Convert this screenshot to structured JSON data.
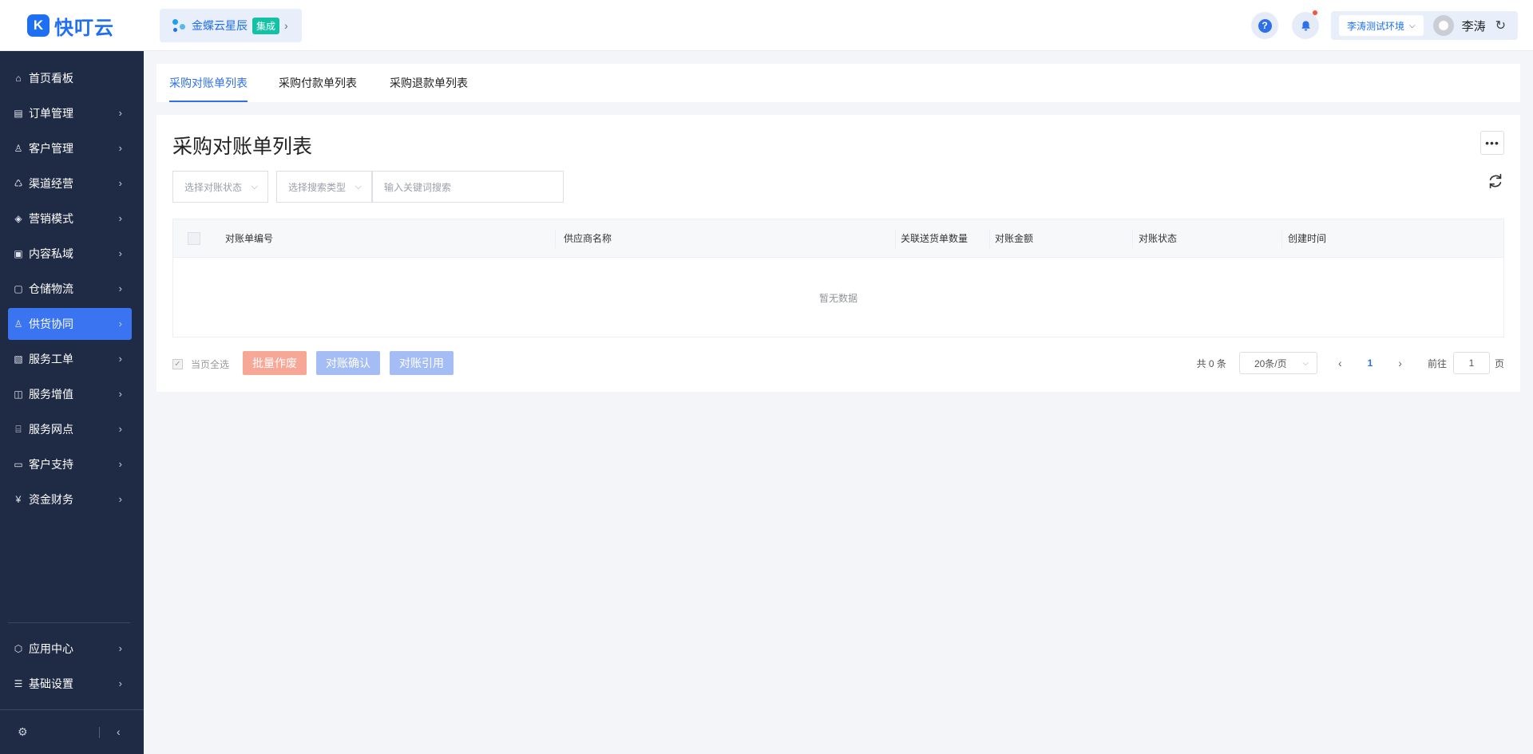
{
  "app": {
    "logo_mark": "K",
    "name": "快叮云"
  },
  "integration": {
    "name": "金蝶云星辰",
    "badge": "集成"
  },
  "header": {
    "help_icon": "?",
    "environment": "李涛测试环境",
    "user_name": "李涛"
  },
  "sidebar": {
    "items": [
      {
        "label": "首页看板",
        "icon": "home-icon",
        "glyph": "⌂"
      },
      {
        "label": "订单管理",
        "icon": "clipboard-icon",
        "glyph": "▤"
      },
      {
        "label": "客户管理",
        "icon": "user-icon",
        "glyph": "♙"
      },
      {
        "label": "渠道经营",
        "icon": "channel-icon",
        "glyph": "♺"
      },
      {
        "label": "营销模式",
        "icon": "tag-icon",
        "glyph": "◈"
      },
      {
        "label": "内容私域",
        "icon": "image-icon",
        "glyph": "▣"
      },
      {
        "label": "仓储物流",
        "icon": "box-icon",
        "glyph": "▢"
      },
      {
        "label": "供货协同",
        "icon": "supplier-icon",
        "glyph": "♙"
      },
      {
        "label": "服务工单",
        "icon": "work-order-icon",
        "glyph": "▧"
      },
      {
        "label": "服务增值",
        "icon": "bag-icon",
        "glyph": "◫"
      },
      {
        "label": "服务网点",
        "icon": "store-icon",
        "glyph": "⌸"
      },
      {
        "label": "客户支持",
        "icon": "support-icon",
        "glyph": "▭"
      },
      {
        "label": "资金财务",
        "icon": "yuan-icon",
        "glyph": "¥"
      }
    ],
    "bottom_items": [
      {
        "label": "应用中心",
        "icon": "cube-icon",
        "glyph": "⬡"
      },
      {
        "label": "基础设置",
        "icon": "settings-icon",
        "glyph": "☰"
      }
    ],
    "active_index": 7
  },
  "tabs": [
    {
      "label": "采购对账单列表"
    },
    {
      "label": "采购付款单列表"
    },
    {
      "label": "采购退款单列表"
    }
  ],
  "main": {
    "title": "采购对账单列表",
    "more_label": "•••",
    "filters": {
      "status_placeholder": "选择对账状态",
      "search_type_placeholder": "选择搜索类型",
      "keyword_placeholder": "输入关键词搜索"
    },
    "table": {
      "columns": [
        "对账单编号",
        "供应商名称",
        "关联送货单数量",
        "对账金额",
        "对账状态",
        "创建时间"
      ],
      "empty_text": "暂无数据"
    },
    "footer": {
      "select_all_label": "当页全选",
      "btn_void": "批量作废",
      "btn_confirm": "对账确认",
      "btn_quote": "对账引用"
    },
    "pagination": {
      "total": "共 0 条",
      "page_size": "20条/页",
      "current_page": "1",
      "jump_label": "前往",
      "jump_value": "1",
      "jump_suffix": "页"
    }
  },
  "colors": {
    "sidebar_bg": "#1f2b45",
    "accent": "#2f6fea",
    "danger_btn": "#f7a795",
    "primary_btn_disabled": "#a5bdf5"
  }
}
